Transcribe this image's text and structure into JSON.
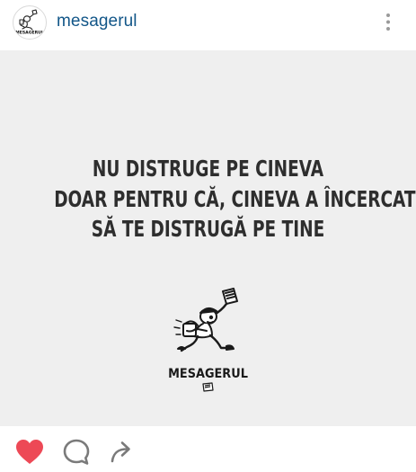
{
  "post": {
    "username": "mesagerul",
    "quote_lines": [
      "NU DISTRUGE PE CINEVA",
      "DOAR PENTRU CĂ, CINEVA A ÎNCERCAT",
      "SĂ TE DISTRUGĂ PE TINE"
    ],
    "brand_text": "MESAGERUL",
    "avatar_logo_text": "MESAGERUL",
    "liked": true
  },
  "actions": {
    "like_icon": "heart-filled-icon",
    "comment_icon": "comment-bubble-icon",
    "share_icon": "share-arrow-icon",
    "more_icon": "more-vertical-icon"
  },
  "colors": {
    "username": "#125688",
    "like_active": "#ed4956",
    "icon_gray": "#7a7a7a",
    "image_background": "#efefef",
    "quote_text": "#2e2e2e"
  }
}
